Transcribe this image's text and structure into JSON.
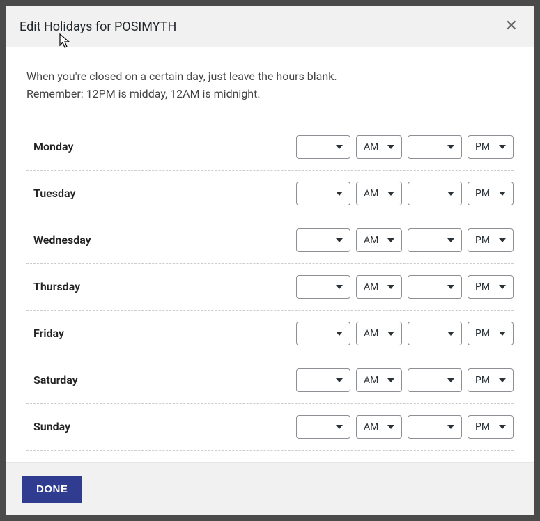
{
  "header": {
    "title": "Edit Holidays for POSIMYTH"
  },
  "instructions": {
    "line1": "When you're closed on a certain day, just leave the hours blank.",
    "line2": "Remember: 12PM is midday, 12AM is midnight."
  },
  "ampm": {
    "am": "AM",
    "pm": "PM"
  },
  "days": {
    "monday": "Monday",
    "tuesday": "Tuesday",
    "wednesday": "Wednesday",
    "thursday": "Thursday",
    "friday": "Friday",
    "saturday": "Saturday",
    "sunday": "Sunday"
  },
  "footer": {
    "done_label": "DONE"
  }
}
